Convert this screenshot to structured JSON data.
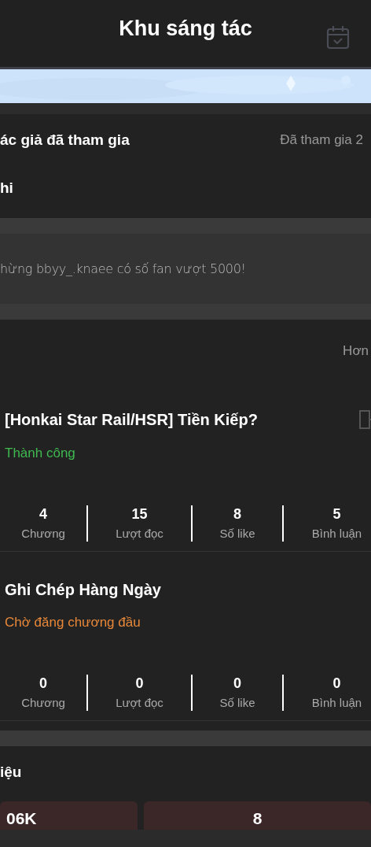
{
  "header": {
    "title": "Khu sáng tác"
  },
  "joined": {
    "label": "ác giả đã tham gia",
    "count": "Đã tham gia 2"
  },
  "section_label": "hi",
  "announcement": "hừng bbyy_.knaee có số fan vượt 5000!",
  "more_link": "Hơn",
  "works": [
    {
      "title": "[Honkai Star Rail/HSR] Tiền Kiếp?",
      "status": "Thành công",
      "kind": "success",
      "has_exit": true,
      "stats": [
        {
          "value": "4",
          "label": "Chương"
        },
        {
          "value": "15",
          "label": "Lượt đọc"
        },
        {
          "value": "8",
          "label": "Số like"
        },
        {
          "value": "5",
          "label": "Bình luận"
        }
      ]
    },
    {
      "title": "Ghi Chép Hàng Ngày",
      "status": "Chờ đăng chương đầu",
      "kind": "pending",
      "has_exit": false,
      "stats": [
        {
          "value": "0",
          "label": "Chương"
        },
        {
          "value": "0",
          "label": "Lượt đọc"
        },
        {
          "value": "0",
          "label": "Số like"
        },
        {
          "value": "0",
          "label": "Bình luận"
        }
      ]
    }
  ],
  "data_section": {
    "title": "iệu",
    "cards": [
      {
        "value": "06K"
      },
      {
        "value": "8"
      }
    ]
  }
}
